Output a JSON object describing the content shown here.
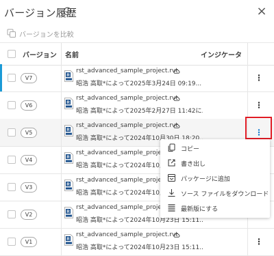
{
  "dialog": {
    "title": "バージョン履歴",
    "close_glyph": "×",
    "compare_label": "バージョンを比較"
  },
  "columns": {
    "version": "バージョン",
    "name": "名前",
    "indicator": "インジケータ"
  },
  "rows": [
    {
      "version": "V7",
      "file": "rst_advanced_sample_project.rvt",
      "meta": "昭浩 高取*によって2025年3月24日 09:19...",
      "current": true
    },
    {
      "version": "V6",
      "file": "rst_advanced_sample_project.rvt",
      "meta": "昭浩 高取*によって2025年2月27日 11:42に...",
      "current": false
    },
    {
      "version": "V5",
      "file": "rst_advanced_sample_project.rvt",
      "meta": "昭浩 高取*によって2024年10月30日 18:20...",
      "current": false
    },
    {
      "version": "V4",
      "file": "rst_advanced_sample_project.rvt",
      "meta": "昭浩 高取*によって2024年10月",
      "current": false
    },
    {
      "version": "V3",
      "file": "rst_advanced_sample_project.rvt",
      "meta": "昭浩 高取*によって2024年10月",
      "current": false
    },
    {
      "version": "V2",
      "file": "rst_advanced_sample_project.rvt",
      "meta": "昭浩 高取*によって2024年10月23日 15:11...",
      "current": false
    },
    {
      "version": "V1",
      "file": "rst_advanced_sample_project.rvt",
      "meta": "昭浩 高取*によって2024年10月23日 15:11...",
      "current": false
    }
  ],
  "context_menu": {
    "items": [
      {
        "label": "コピー",
        "icon": "copy-icon"
      },
      {
        "label": "書き出し",
        "icon": "export-icon"
      },
      {
        "label": "パッケージに追加",
        "icon": "package-icon"
      },
      {
        "label": "ソース ファイルをダウンロード",
        "icon": "download-icon"
      },
      {
        "label": "最新版にする",
        "icon": "promote-icon"
      }
    ]
  },
  "colors": {
    "accent": "#1b9ad6",
    "highlight": "#e01b24",
    "revit": "#1a4f8b"
  }
}
